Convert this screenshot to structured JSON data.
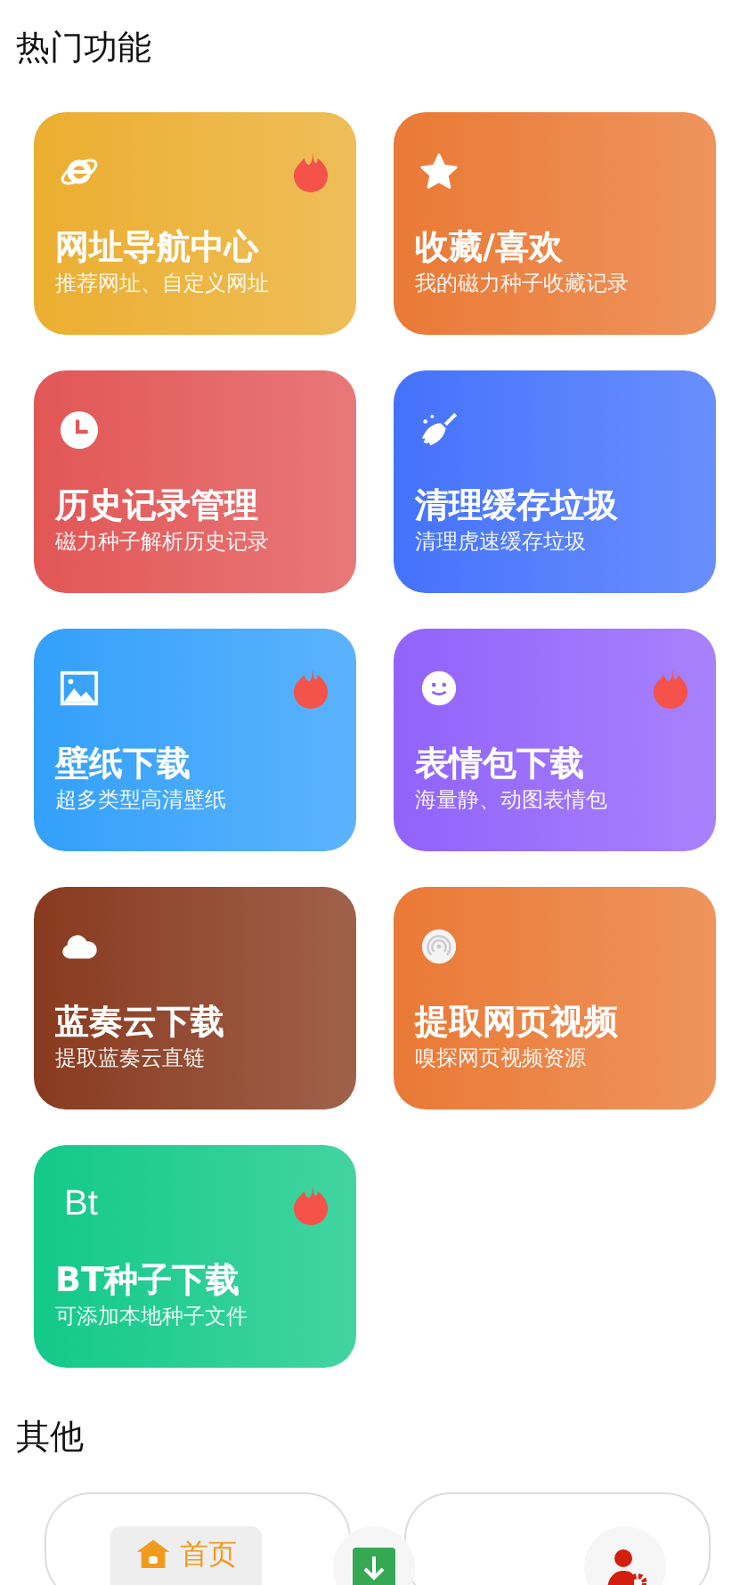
{
  "hot_section": {
    "title": "热门功能",
    "cards": [
      {
        "title": "网址导航中心",
        "subtitle": "推荐网址、自定义网址",
        "kind": "browser",
        "hot": true,
        "color": "#ebae30"
      },
      {
        "title": "收藏/喜欢",
        "subtitle": "我的磁力种子收藏记录",
        "kind": "star",
        "hot": false,
        "color": "#ea7935"
      },
      {
        "title": "历史记录管理",
        "subtitle": "磁力种子解析历史记录",
        "kind": "clock",
        "hot": false,
        "color": "#e25656"
      },
      {
        "title": "清理缓存垃圾",
        "subtitle": "清理虎速缓存垃圾",
        "kind": "broom",
        "hot": false,
        "color": "#4472fb"
      },
      {
        "title": "壁纸下载",
        "subtitle": "超多类型高清壁纸",
        "kind": "image",
        "hot": true,
        "color": "#33a0fb"
      },
      {
        "title": "表情包下载",
        "subtitle": "海量静、动图表情包",
        "kind": "smile",
        "hot": true,
        "color": "#9163fb"
      },
      {
        "title": "蓝奏云下载",
        "subtitle": "提取蓝奏云直链",
        "kind": "cloud",
        "hot": false,
        "color": "#883a1e"
      },
      {
        "title": "提取网页视频",
        "subtitle": "嗅探网页视频资源",
        "kind": "signal",
        "hot": false,
        "color": "#ea7935"
      },
      {
        "title": "BT种子下载",
        "subtitle": "可添加本地种子文件",
        "kind": "text",
        "icon_text": "Bt",
        "hot": true,
        "color": "#13c98a"
      }
    ]
  },
  "other_section": {
    "title": "其他"
  },
  "bottom_nav": [
    {
      "kind": "tab",
      "label": "首页",
      "selected": true
    },
    {
      "kind": "download",
      "selected": false
    },
    {
      "kind": "profile",
      "selected": false
    }
  ]
}
